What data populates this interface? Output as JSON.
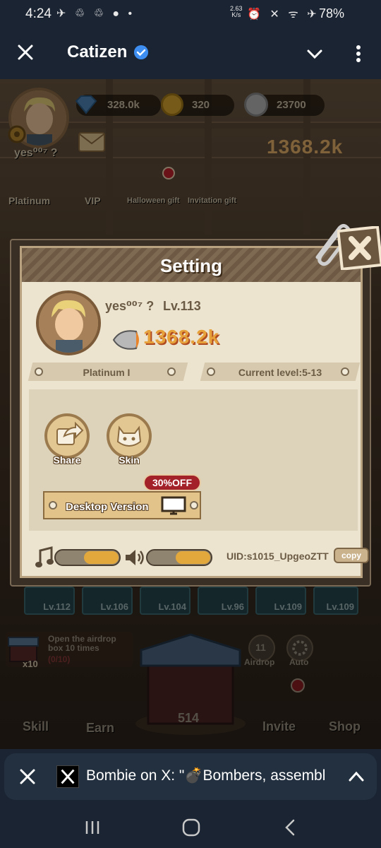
{
  "status_bar": {
    "time": "4:24",
    "left_icons": "✈ ♲ ♲ ● •",
    "net_rate_top": "2.63",
    "net_rate_bottom": "K/s",
    "right_icons": "⏰ ✕ ᯤ ✈",
    "battery": "78%"
  },
  "app_bar": {
    "title": "Catizen"
  },
  "game_hud": {
    "player_name": "yes⁰⁰⁷ ?",
    "gems": "328.0k",
    "coins": "320",
    "silver": "23700",
    "power": "1368.2k",
    "rank_short": "Platinum",
    "vip_label": "VIP",
    "halloween_label": "Halloween gift",
    "invitation_label": "Invitation gift"
  },
  "dialog": {
    "title": "Setting",
    "player_name": "yes⁰⁰⁷ ?",
    "level": "Lv.113",
    "power": "1368.2k",
    "rank": "Platinum I",
    "current_level": "Current level:5-13",
    "share_label": "Share",
    "skin_label": "Skin",
    "desktop_label": "Desktop Version",
    "discount": "30%OFF",
    "music_level": 0.55,
    "sound_level": 0.55,
    "uid": "UID:s1015_UpgeoZTT",
    "copy_label": "copy"
  },
  "bottom_hud": {
    "levels": [
      "Lv.112",
      "Lv.106",
      "Lv.104",
      "Lv.96",
      "Lv.109",
      "Lv.109"
    ],
    "airdrop_text": "Open the airdrop box 10 times",
    "airdrop_progress": "(0/10)",
    "airdrop_multiplier": "x10",
    "airdrop_count": "11",
    "airdrop_label": "Airdrop",
    "auto_label": "Auto",
    "box_count": "514",
    "skill_label": "Skill",
    "earn_label": "Earn",
    "invite_label": "Invite",
    "shop_label": "Shop"
  },
  "notification": {
    "text": "Bombie on X: \"💣Bombers, assembl"
  },
  "colors": {
    "bar_bg": "#1b2433",
    "dialog_paper": "#ece4cf",
    "accent_orange": "#e3a83b",
    "verified_blue": "#3d8ef0"
  }
}
